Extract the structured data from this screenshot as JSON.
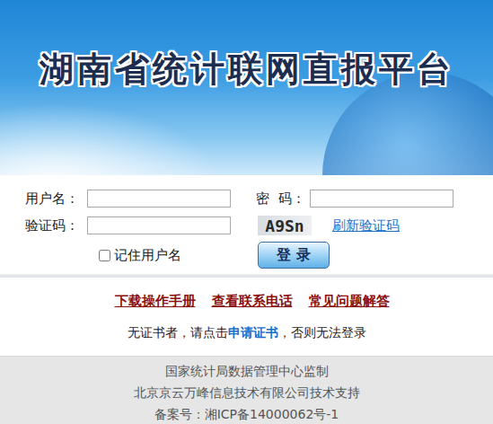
{
  "banner": {
    "title": "湖南省统计联网直报平台"
  },
  "login_form": {
    "username": {
      "label": "用户名：",
      "value": ""
    },
    "password": {
      "label": "密  码：",
      "value": ""
    },
    "captcha": {
      "label": "验证码：",
      "value": "",
      "code": "A9Sn",
      "refresh": "刷新验证码"
    },
    "remember": {
      "label": "记住用户名",
      "checked": false
    },
    "submit": "登 录"
  },
  "links": [
    "下载操作手册",
    "查看联系电话",
    "常见问题解答"
  ],
  "notice": {
    "before": "无证书者，请点击",
    "link": "申请证书",
    "after": "，否则无法登录"
  },
  "footer": [
    "国家统计局数据管理中心监制",
    "北京京云万峰信息技术有限公司技术支持",
    "备案号：湘ICP备14000062号-1"
  ]
}
